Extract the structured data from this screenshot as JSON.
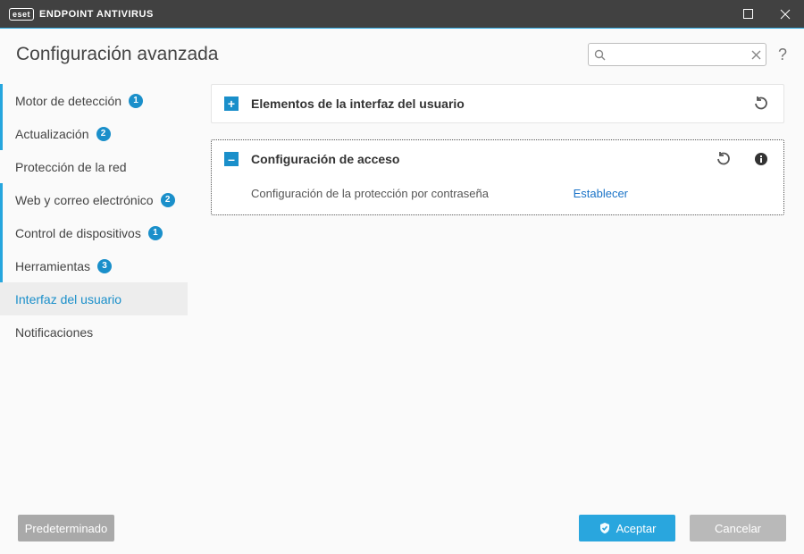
{
  "titlebar": {
    "brand": "eset",
    "product": "ENDPOINT ANTIVIRUS"
  },
  "header": {
    "title": "Configuración avanzada",
    "search_placeholder": "",
    "help_label": "?"
  },
  "sidebar": {
    "items": [
      {
        "label": "Motor de detección",
        "badge": "1",
        "level1": true,
        "active": false
      },
      {
        "label": "Actualización",
        "badge": "2",
        "level1": true,
        "active": false
      },
      {
        "label": "Protección de la red",
        "badge": "",
        "level1": false,
        "active": false
      },
      {
        "label": "Web y correo electrónico",
        "badge": "2",
        "level1": true,
        "active": false
      },
      {
        "label": "Control de dispositivos",
        "badge": "1",
        "level1": true,
        "active": false
      },
      {
        "label": "Herramientas",
        "badge": "3",
        "level1": true,
        "active": false
      },
      {
        "label": "Interfaz del usuario",
        "badge": "",
        "level1": false,
        "active": true
      },
      {
        "label": "Notificaciones",
        "badge": "",
        "level1": false,
        "active": false
      }
    ]
  },
  "panels": {
    "ui_elements": {
      "title": "Elementos de la interfaz del usuario",
      "expanded": false
    },
    "access": {
      "title": "Configuración de acceso",
      "expanded": true,
      "row_label": "Configuración de la protección por contraseña",
      "row_action": "Establecer"
    }
  },
  "footer": {
    "default": "Predeterminado",
    "accept": "Aceptar",
    "cancel": "Cancelar"
  }
}
